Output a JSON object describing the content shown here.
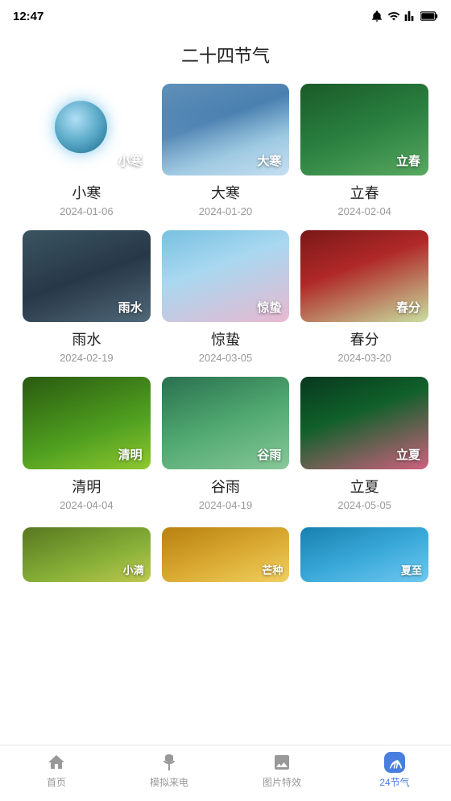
{
  "statusBar": {
    "time": "12:47"
  },
  "pageTitle": "二十四节气",
  "items": [
    {
      "name": "小寒",
      "date": "2024-01-06",
      "bg": "xiaohan",
      "label": "小寒"
    },
    {
      "name": "大寒",
      "date": "2024-01-20",
      "bg": "dahan",
      "label": "大寒"
    },
    {
      "name": "立春",
      "date": "2024-02-04",
      "bg": "lichun",
      "label": "立春"
    },
    {
      "name": "雨水",
      "date": "2024-02-19",
      "bg": "yushui",
      "label": "雨水"
    },
    {
      "name": "惊蛰",
      "date": "2024-03-05",
      "bg": "jingzhe",
      "label": "惊蛰"
    },
    {
      "name": "春分",
      "date": "2024-03-20",
      "bg": "chunfen",
      "label": "春分"
    },
    {
      "name": "清明",
      "date": "2024-04-04",
      "bg": "qingming",
      "label": "清明"
    },
    {
      "name": "谷雨",
      "date": "2024-04-19",
      "bg": "guyu",
      "label": "谷雨"
    },
    {
      "name": "立夏",
      "date": "2024-05-05",
      "bg": "lixia",
      "label": "立夏"
    }
  ],
  "partialItems": [
    {
      "name": "小满",
      "bg": "xiaoman",
      "label": "小满"
    },
    {
      "name": "芒种",
      "bg": "mangzhong",
      "label": "芒种"
    },
    {
      "name": "夏至",
      "bg": "xiazhi",
      "label": "夏至"
    }
  ],
  "nav": {
    "items": [
      {
        "key": "home",
        "label": "首页",
        "active": false
      },
      {
        "key": "simulate",
        "label": "模拟来电",
        "active": false
      },
      {
        "key": "effects",
        "label": "图片特效",
        "active": false
      },
      {
        "key": "jieqi",
        "label": "24节气",
        "active": true
      }
    ]
  }
}
